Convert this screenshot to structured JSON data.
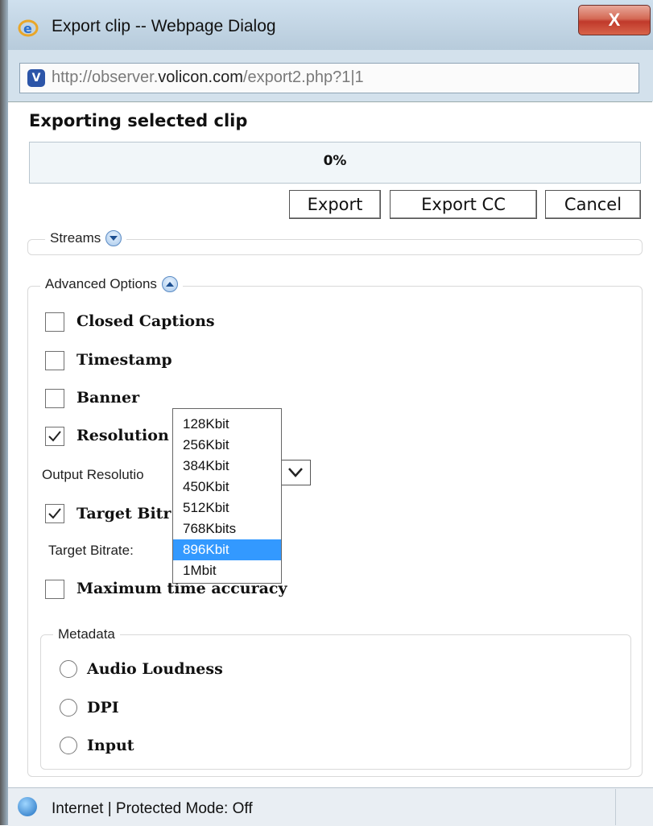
{
  "window": {
    "title": "Export clip -- Webpage Dialog",
    "close_label": "X",
    "url_prefix": "http://observer.",
    "url_domain": "volicon.com",
    "url_suffix": "/export2.php?1|1"
  },
  "main": {
    "heading": "Exporting selected clip",
    "progress_text": "0%",
    "progress_value": 0,
    "buttons": {
      "export": "Export",
      "export_cc": "Export CC",
      "cancel": "Cancel"
    }
  },
  "streams": {
    "legend": "Streams",
    "toggle_icon": "chevron-down-icon"
  },
  "advanced": {
    "legend": "Advanced Options",
    "toggle_icon": "chevron-up-icon",
    "closed_captions": {
      "label": "Closed Captions",
      "checked": false
    },
    "timestamp": {
      "label": "Timestamp",
      "checked": false
    },
    "banner": {
      "label": "Banner",
      "checked": false
    },
    "resolution": {
      "label": "Resolution",
      "checked": true
    },
    "output_resolution_label": "Output Resolutio",
    "target_bitrate": {
      "label": "Target Bitr",
      "checked": true
    },
    "target_bitrate_label": "Target Bitrate:",
    "max_time_accuracy": {
      "label": "Maximum time accuracy",
      "checked": false
    }
  },
  "dropdown": {
    "options": [
      "128Kbit",
      "256Kbit",
      "384Kbit",
      "450Kbit",
      "512Kbit",
      "768Kbits",
      "896Kbit",
      "1Mbit"
    ],
    "selected": "896Kbit"
  },
  "metadata": {
    "legend": "Metadata",
    "options": [
      "Audio Loudness",
      "DPI",
      "Input"
    ]
  },
  "statusbar": {
    "text": "Internet | Protected Mode: Off"
  },
  "colors": {
    "highlight": "#3399ff",
    "close": "#c0392b"
  }
}
